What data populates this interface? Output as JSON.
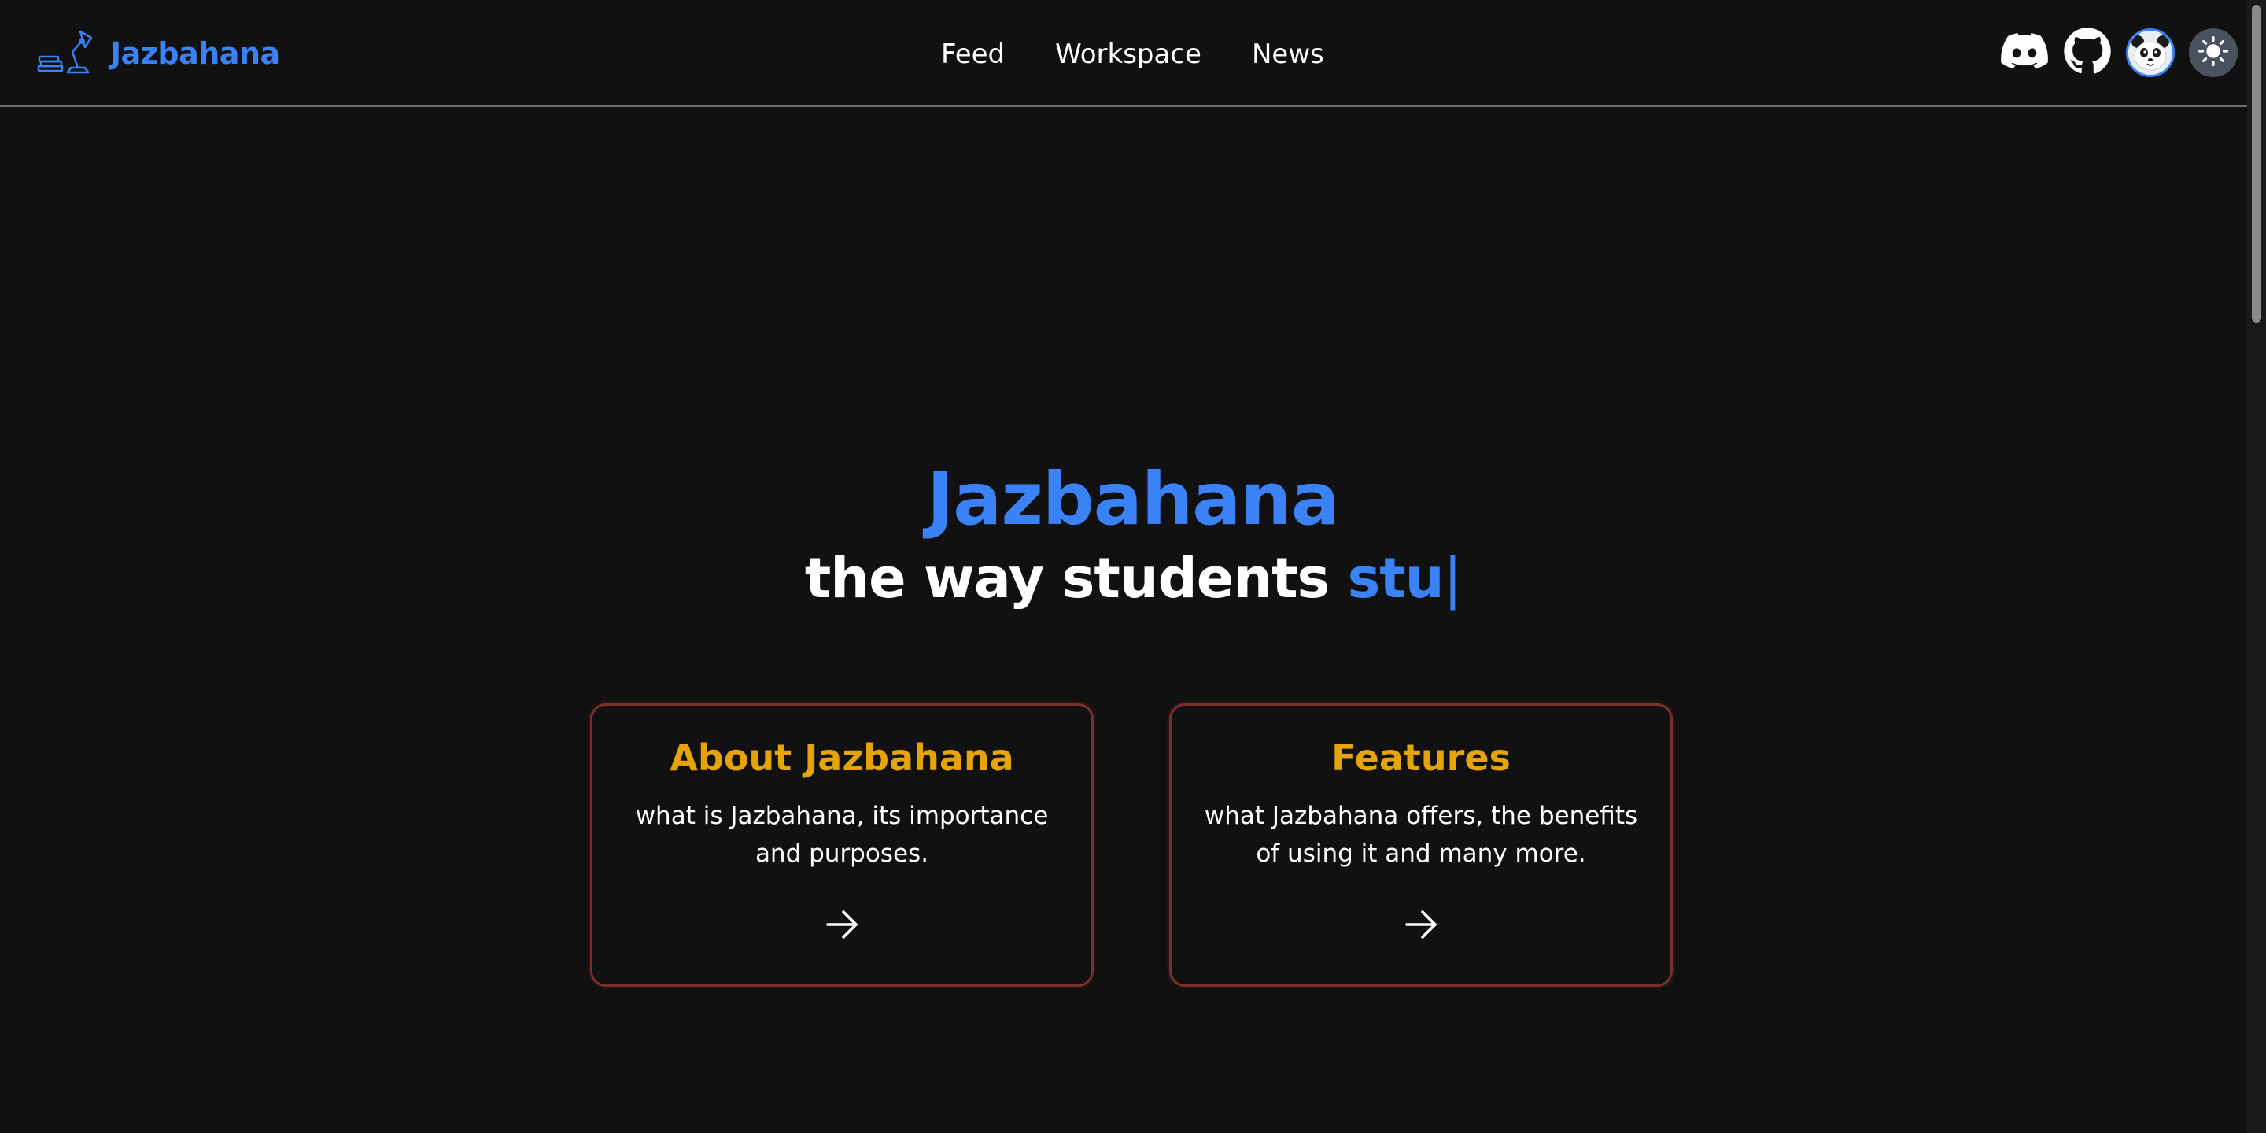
{
  "header": {
    "brand_name": "Jazbahana",
    "nav": [
      {
        "label": "Feed"
      },
      {
        "label": "Workspace"
      },
      {
        "label": "News"
      }
    ],
    "icons": [
      "discord-icon",
      "github-icon",
      "avatar",
      "sun-icon"
    ]
  },
  "hero": {
    "title": "Jazbahana",
    "tagline_static": "the way students ",
    "tagline_typed": "stu",
    "cursor": "|"
  },
  "cards": [
    {
      "title": "About Jazbahana",
      "description": "what is Jazbahana, its importance and purposes."
    },
    {
      "title": "Features",
      "description": "what Jazbahana offers, the benefits of using it and many more."
    }
  ],
  "colors": {
    "background": "#111111",
    "brand_blue": "#3b82f6",
    "card_title_gold": "#e5a50a",
    "card_border": "#7a2e2e"
  }
}
